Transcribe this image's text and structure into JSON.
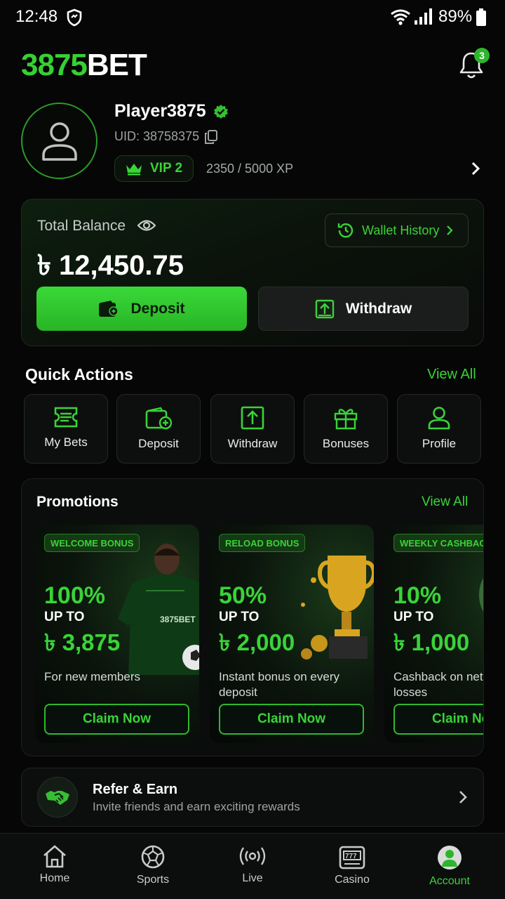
{
  "status_bar": {
    "time": "12:48",
    "battery": "89%"
  },
  "header": {
    "logo_num": "3875",
    "logo_word": "BET",
    "notification_count": "3"
  },
  "profile": {
    "name": "Player3875",
    "uid": "UID: 38758375",
    "vip": "VIP 2",
    "xp": "2350 / 5000 XP"
  },
  "balance": {
    "label": "Total Balance",
    "amount": "৳ 12,450.75",
    "wallet_history": "Wallet History",
    "deposit": "Deposit",
    "withdraw": "Withdraw"
  },
  "quick_actions": {
    "title": "Quick Actions",
    "view_all": "View All",
    "items": [
      {
        "label": "My Bets",
        "icon": "ticket-icon"
      },
      {
        "label": "Deposit",
        "icon": "wallet-plus-icon"
      },
      {
        "label": "Withdraw",
        "icon": "withdraw-icon"
      },
      {
        "label": "Bonuses",
        "icon": "gift-icon"
      },
      {
        "label": "Profile",
        "icon": "user-icon"
      }
    ]
  },
  "promotions": {
    "title": "Promotions",
    "view_all": "View All",
    "cards": [
      {
        "badge": "WELCOME BONUS",
        "pct": "100%",
        "upto": "UP TO",
        "amount": "৳ 3,875",
        "desc": "For new members",
        "claim": "Claim Now"
      },
      {
        "badge": "RELOAD BONUS",
        "pct": "50%",
        "upto": "UP TO",
        "amount": "৳ 2,000",
        "desc": "Instant bonus on every deposit",
        "claim": "Claim Now"
      },
      {
        "badge": "WEEKLY CASHBACK",
        "pct": "10%",
        "upto": "UP TO",
        "amount": "৳ 1,000",
        "desc": "Cashback on net losses",
        "claim": "Claim Now"
      }
    ]
  },
  "refer": {
    "title": "Refer & Earn",
    "subtitle": "Invite friends and earn exciting rewards"
  },
  "nav": {
    "items": [
      {
        "label": "Home",
        "icon": "home-icon"
      },
      {
        "label": "Sports",
        "icon": "soccer-ball-icon"
      },
      {
        "label": "Live",
        "icon": "broadcast-icon"
      },
      {
        "label": "Casino",
        "icon": "slot-machine-icon"
      },
      {
        "label": "Account",
        "icon": "account-icon"
      }
    ],
    "active": "Account"
  },
  "colors": {
    "accent": "#3ad338",
    "background": "#050605"
  }
}
